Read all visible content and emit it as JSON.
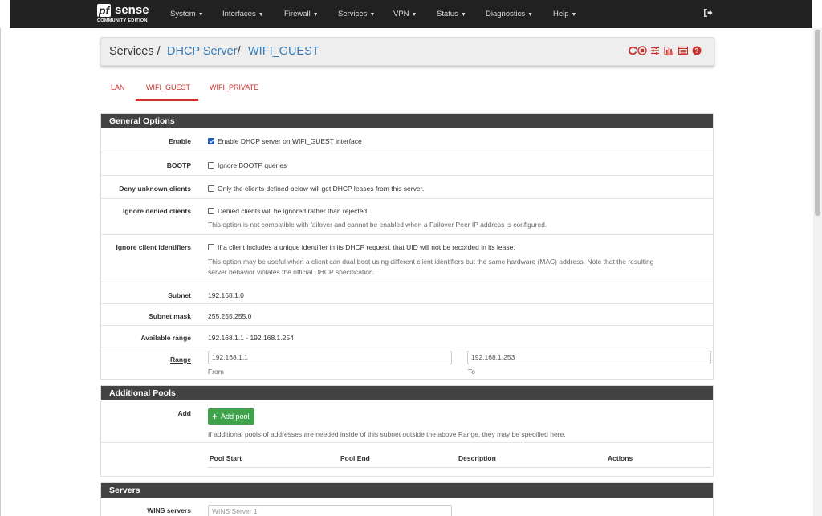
{
  "navbar": {
    "logo_pf": "pf",
    "logo_sense": "sense",
    "logo_edition": "COMMUNITY EDITION",
    "items": [
      {
        "label": "System"
      },
      {
        "label": "Interfaces"
      },
      {
        "label": "Firewall"
      },
      {
        "label": "Services"
      },
      {
        "label": "VPN"
      },
      {
        "label": "Status"
      },
      {
        "label": "Diagnostics"
      },
      {
        "label": "Help"
      }
    ],
    "logout_icon": "sign-out-icon"
  },
  "breadcrumb": {
    "services": "Services",
    "dhcp": "DHCP Server",
    "iface": "WIFI_GUEST",
    "sep": "/",
    "icons": [
      "restart-service-icon",
      "stop-service-icon",
      "sliders-icon",
      "chart-icon",
      "log-icon",
      "help-icon"
    ]
  },
  "tabs": [
    {
      "label": "LAN"
    },
    {
      "label": "WIFI_GUEST",
      "active": true
    },
    {
      "label": "WIFI_PRIVATE"
    }
  ],
  "general": {
    "heading": "General Options",
    "enable": {
      "label": "Enable",
      "text": "Enable DHCP server on WIFI_GUEST interface",
      "checked": true
    },
    "bootp": {
      "label": "BOOTP",
      "text": "Ignore BOOTP queries",
      "checked": false
    },
    "deny": {
      "label": "Deny unknown clients",
      "text": "Only the clients defined below will get DHCP leases from this server.",
      "checked": false
    },
    "ignore_denied": {
      "label": "Ignore denied clients",
      "text": "Denied clients will be ignored rather than rejected.",
      "help": "This option is not compatible with failover and cannot be enabled when a Failover Peer IP address is configured.",
      "checked": false
    },
    "ignore_uid": {
      "label": "Ignore client identifiers",
      "text": "If a client includes a unique identifier in its DHCP request, that UID will not be recorded in its lease.",
      "help1": "This option may be useful when a client can dual boot using different client identifiers but the same hardware (MAC) address. Note that the resulting",
      "help2": "server behavior violates the official DHCP specification.",
      "checked": false
    },
    "subnet": {
      "label": "Subnet",
      "value": "192.168.1.0"
    },
    "mask": {
      "label": "Subnet mask",
      "value": "255.255.255.0"
    },
    "avail": {
      "label": "Available range",
      "value": "192.168.1.1 - 192.168.1.254"
    },
    "range": {
      "label": "Range",
      "from": "192.168.1.1",
      "to": "192.168.1.253",
      "from_label": "From",
      "to_label": "To"
    }
  },
  "pools": {
    "heading": "Additional Pools",
    "add_label": "Add",
    "add_button": "Add pool",
    "help": "If additional pools of addresses are needed inside of this subnet outside the above Range, they may be specified here.",
    "columns": [
      "Pool Start",
      "Pool End",
      "Description",
      "Actions"
    ]
  },
  "servers": {
    "heading": "Servers",
    "wins_label": "WINS servers",
    "wins_placeholder": "WINS Server 1"
  }
}
